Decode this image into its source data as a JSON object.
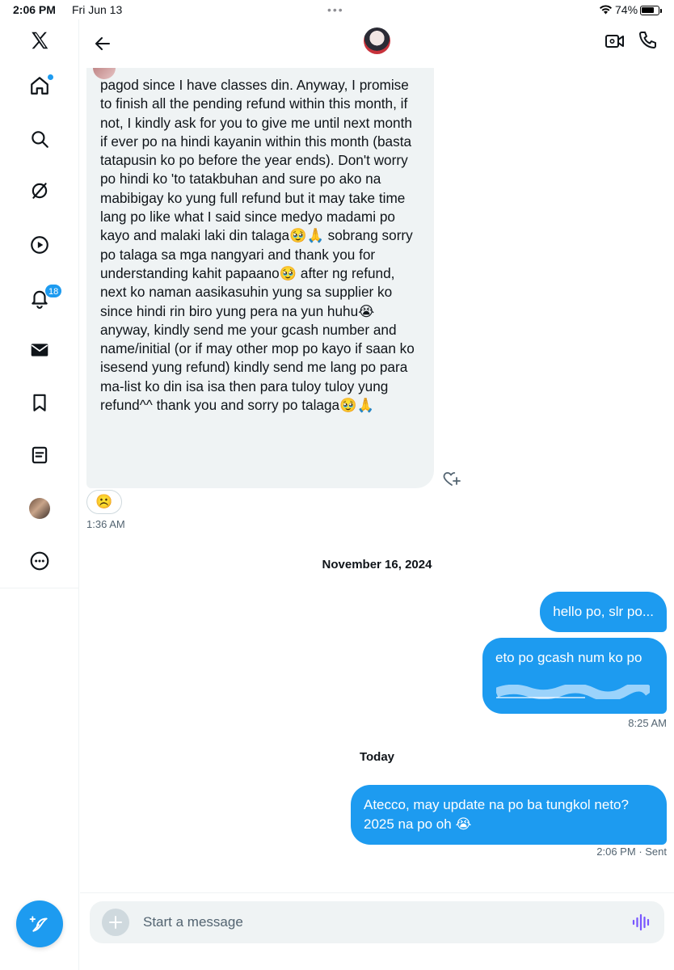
{
  "status_bar": {
    "time": "2:06 PM",
    "date": "Fri Jun 13",
    "dots": "•••",
    "battery": "74%"
  },
  "nav": {
    "items": [
      {
        "name": "x-logo-icon"
      },
      {
        "name": "home-icon"
      },
      {
        "name": "search-icon"
      },
      {
        "name": "grok-icon"
      },
      {
        "name": "video-icon"
      },
      {
        "name": "notifications-icon",
        "badge": "18"
      },
      {
        "name": "messages-icon"
      },
      {
        "name": "bookmarks-icon"
      },
      {
        "name": "lists-icon"
      },
      {
        "name": "profile-avatar"
      },
      {
        "name": "more-icon"
      },
      {
        "name": "compose-icon"
      }
    ],
    "notifications_badge": "18"
  },
  "header": {
    "icons": [
      "back-arrow-icon",
      "avatar",
      "video-call-icon",
      "phone-icon"
    ]
  },
  "conversation": {
    "incoming": {
      "text": "pagod since I have classes din. Anyway, I promise to finish all the pending refund within this month, if not, I kindly ask for you to give me until next month if ever po na hindi kayanin within this month (basta tatapusin ko po before the year ends). Don't worry po hindi ko 'to tatakbuhan and sure po ako na mabibigay ko yung full refund but it may take time lang po like what I said since medyo madami po kayo and malaki laki din talaga🥹🙏 sobrang sorry po talaga sa mga nangyari and thank you for understanding kahit papaano🥹 after ng refund, next ko naman aasikasuhin yung sa supplier ko since hindi rin biro yung pera na yun huhu😭 anyway, kindly send me your gcash number and name/initial (or if may other mop po kayo if saan ko isesend yung refund) kindly send me lang po para ma-list ko din isa isa then para tuloy tuloy yung refund^^ thank you and sorry po talaga🥹🙏",
      "reaction": "☹️",
      "time": "1:36 AM"
    },
    "date_separators": [
      "November 16, 2024",
      "Today"
    ],
    "outgoing": [
      {
        "text": "hello po, slr po...",
        "time": ""
      },
      {
        "text": "eto po gcash num ko po",
        "time": "8:25 AM"
      },
      {
        "text": "Atecco, may update na po ba tungkol neto? 2025 na po oh 😭",
        "time": "2:06 PM",
        "status": "· Sent"
      }
    ]
  },
  "composer": {
    "placeholder": "Start a message"
  },
  "colors": {
    "accent": "#1d9bf0",
    "incoming_bubble": "#eff3f4",
    "text": "#0f1419",
    "muted": "#536471"
  }
}
